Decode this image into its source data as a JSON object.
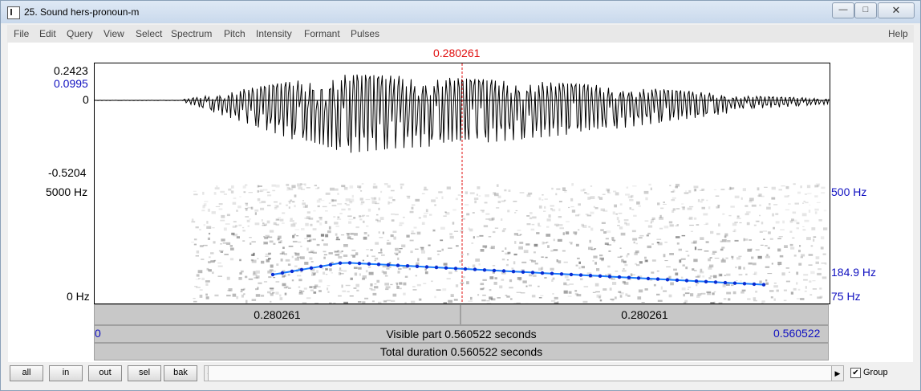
{
  "window": {
    "title": "25. Sound hers-pronoun-m",
    "buttons": {
      "minimize": "—",
      "maximize": "□",
      "close": "✕"
    }
  },
  "menu": [
    "File",
    "Edit",
    "Query",
    "View",
    "Select",
    "Spectrum",
    "Pitch",
    "Intensity",
    "Formant",
    "Pulses",
    "Help"
  ],
  "cursor": {
    "time": "0.280261"
  },
  "waveform": {
    "max": "0.2423",
    "mark": "0.0995",
    "zero": "0",
    "min": "-0.5204"
  },
  "spectrogram": {
    "freq_max": "5000 Hz",
    "freq_min": "0 Hz",
    "pitch_max": "500 Hz",
    "pitch_cursor": "184.9 Hz",
    "pitch_min": "75 Hz"
  },
  "timebar": {
    "left_segment": "0.280261",
    "right_segment": "0.280261",
    "start": "0",
    "end": "0.560522",
    "visible": "Visible part 0.560522 seconds",
    "total": "Total duration 0.560522 seconds"
  },
  "nav": {
    "all": "all",
    "in": "in",
    "out": "out",
    "sel": "sel",
    "bak": "bak",
    "group_label": "Group",
    "group_checked": "✔"
  },
  "colors": {
    "pitch": "#1a7bff",
    "cursor": "#e01010",
    "axis_blue": "#1010c0"
  }
}
